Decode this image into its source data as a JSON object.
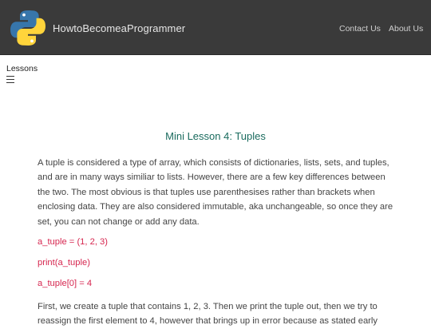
{
  "header": {
    "brand": "HowtoBecomeaProgrammer",
    "logo_icon": "python-logo-icon",
    "nav": [
      {
        "label": "Contact Us"
      },
      {
        "label": "About Us"
      }
    ],
    "colors": {
      "bar": "#3a3a3a",
      "python_blue": "#3776ab",
      "python_yellow": "#ffd43b"
    }
  },
  "sidebar": {
    "label": "Lessons",
    "menu_icon": "hamburger-menu-icon"
  },
  "lesson": {
    "title": "Mini Lesson 4: Tuples",
    "intro": "A tuple is considered a type of array, which consists of dictionaries, lists, sets, and tuples, and are in many ways similiar to lists. However, there are a few key differences between the two. The most obvious is that tuples use parenthesises rather than brackets when enclosing data. They are also considered immutable, aka unchangeable, so once they are set, you can not change or add any data.",
    "code": [
      "a_tuple = (1, 2, 3)",
      "print(a_tuple)",
      "a_tuple[0] = 4"
    ],
    "explanation": "First, we create a tuple that contains 1, 2, 3. Then we print the tuple out, then we try to reassign the first element to 4, however that brings up in error because as stated early"
  }
}
